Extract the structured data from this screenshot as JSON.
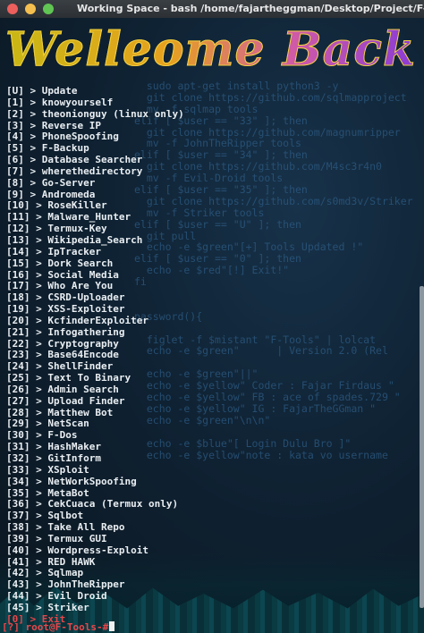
{
  "window": {
    "title": "Working Space - bash  /home/fajartheggman/Desktop/Project/F-Too"
  },
  "banner": {
    "text": "Welleome Back"
  },
  "menu": [
    {
      "key": "[U]",
      "label": "Update"
    },
    {
      "key": "[1]",
      "label": "knowyourself"
    },
    {
      "key": "[2]",
      "label": "theonionguy (linux only)"
    },
    {
      "key": "[3]",
      "label": "Reverse IP"
    },
    {
      "key": "[4]",
      "label": "PhoneSpoofing"
    },
    {
      "key": "[5]",
      "label": "F-Backup"
    },
    {
      "key": "[6]",
      "label": "Database Searcher"
    },
    {
      "key": "[7]",
      "label": "wherethedirectory"
    },
    {
      "key": "[8]",
      "label": "Go-Server"
    },
    {
      "key": "[9]",
      "label": "Andromeda"
    },
    {
      "key": "[10]",
      "label": "RoseKiller"
    },
    {
      "key": "[11]",
      "label": "Malware_Hunter"
    },
    {
      "key": "[12]",
      "label": "Termux-Key"
    },
    {
      "key": "[13]",
      "label": "Wikipedia_Search"
    },
    {
      "key": "[14]",
      "label": "IpTracker"
    },
    {
      "key": "[15]",
      "label": "Dork Search"
    },
    {
      "key": "[16]",
      "label": "Social Media"
    },
    {
      "key": "[17]",
      "label": "Who Are You"
    },
    {
      "key": "[18]",
      "label": "CSRD-Uploader"
    },
    {
      "key": "[19]",
      "label": "XSS-Exploiter"
    },
    {
      "key": "[20]",
      "label": "KcfinderExploiter"
    },
    {
      "key": "[21]",
      "label": "Infogathering"
    },
    {
      "key": "[22]",
      "label": "Cryptography"
    },
    {
      "key": "[23]",
      "label": "Base64Encode"
    },
    {
      "key": "[24]",
      "label": "ShellFinder"
    },
    {
      "key": "[25]",
      "label": "Text To Binary"
    },
    {
      "key": "[26]",
      "label": "Admin Search"
    },
    {
      "key": "[27]",
      "label": "Upload Finder"
    },
    {
      "key": "[28]",
      "label": "Matthew Bot"
    },
    {
      "key": "[29]",
      "label": "NetScan"
    },
    {
      "key": "[30]",
      "label": "F-Dos"
    },
    {
      "key": "[31]",
      "label": "HashMaker"
    },
    {
      "key": "[32]",
      "label": "GitInform"
    },
    {
      "key": "[33]",
      "label": "XSploit"
    },
    {
      "key": "[34]",
      "label": "NetWorkSpoofing"
    },
    {
      "key": "[35]",
      "label": "MetaBot"
    },
    {
      "key": "[36]",
      "label": "CekCuaca (Termux only)"
    },
    {
      "key": "[37]",
      "label": "Sqlbot"
    },
    {
      "key": "[38]",
      "label": "Take All Repo"
    },
    {
      "key": "[39]",
      "label": "Termux GUI"
    },
    {
      "key": "[40]",
      "label": "Wordpress-Exploit"
    },
    {
      "key": "[41]",
      "label": "RED HAWK"
    },
    {
      "key": "[42]",
      "label": "Sqlmap"
    },
    {
      "key": "[43]",
      "label": "JohnTheRipper"
    },
    {
      "key": "[44]",
      "label": "Evil Droid"
    },
    {
      "key": "[45]",
      "label": "Striker"
    }
  ],
  "exit_item": {
    "key": "[0]",
    "label": "Exit"
  },
  "arrow": ">",
  "prompt": {
    "text": "[?] root@F-Tools-#"
  },
  "background_code": [
    "  sudo apt-get install python3 -y",
    "  git clone https://github.com/sqlmapproject",
    "  mv -f sqlmap tools",
    "elif [ $user == \"33\" ]; then",
    "  git clone https://github.com/magnumripper",
    "  mv -f JohnTheRipper tools",
    "elif [ $user == \"34\" ]; then",
    "  git clone https://github.com/M4sc3r4n0",
    "  mv -f Evil-Droid tools",
    "elif [ $user == \"35\" ]; then",
    "  git clone https://github.com/s0md3v/Striker",
    "  mv -f Striker tools",
    "elif [ $user == \"U\" ]; then",
    "  git pull",
    "  echo -e $green\"[+] Tools Updated !\"",
    "elif [ $user == \"0\" ]; then",
    "  echo -e $red\"[!] Exit!\"",
    "fi",
    "",
    "",
    "password(){",
    "",
    "  figlet -f $mistant \"F-Tools\" | lolcat",
    "  echo -e $green\"      | Version 2.0 (Rel",
    "",
    "  echo -e $green\"||\"",
    "  echo -e $yellow\" Coder : Fajar Firdaus \"",
    "  echo -e $yellow\" FB : ace of spades.729 \"",
    "  echo -e $yellow\" IG : FajarTheGGman \"",
    "  echo -e $green\"\\n\\n\"",
    "",
    "  echo -e $blue\"[ Login Dulu Bro ]\"",
    "  echo -e $yellow\"note : kata vo username"
  ],
  "colors": {
    "exit": "#e8464a",
    "menu_text": "#e9eef2",
    "background": "#0d1a24"
  }
}
